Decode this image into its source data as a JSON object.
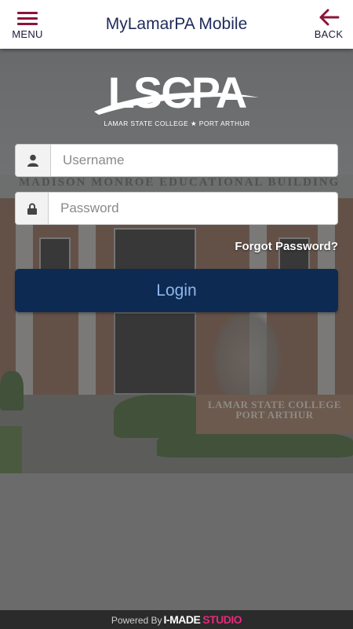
{
  "header": {
    "menu_label": "MENU",
    "title": "MyLamarPA Mobile",
    "back_label": "BACK",
    "accent_color": "#8a1538"
  },
  "logo": {
    "text": "LSCPA",
    "tagline": "LAMAR STATE COLLEGE ★ PORT ARTHUR"
  },
  "background": {
    "building_text": "MADISON MONROE EDUCATIONAL BUILDING",
    "sign_line1": "LAMAR STATE COLLEGE",
    "sign_line2": "PORT ARTHUR"
  },
  "form": {
    "username_placeholder": "Username",
    "username_icon": "user-icon",
    "password_placeholder": "Password",
    "password_icon": "lock-icon",
    "forgot_label": "Forgot Password?",
    "login_label": "Login"
  },
  "footer": {
    "powered_by": "Powered By",
    "brand_part1": "I-MADE",
    "brand_part2": "STUDIO"
  }
}
